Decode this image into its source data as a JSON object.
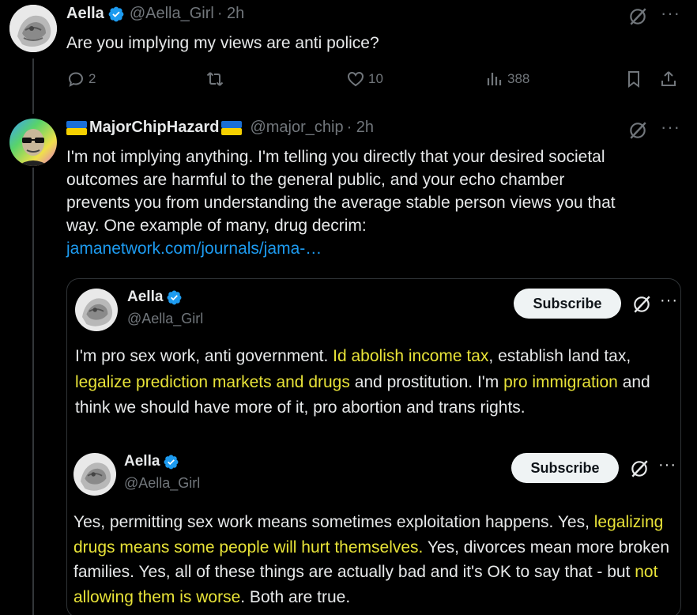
{
  "tweet1": {
    "name": "Aella",
    "handle": "@Aella_Girl",
    "time": "· 2h",
    "text": "Are you implying my views are anti police?",
    "replies": "2",
    "retweets": "",
    "likes": "10",
    "views": "388"
  },
  "tweet2": {
    "name": "MajorChipHazard",
    "handle": "@major_chip",
    "time": "· 2h",
    "text_lines": [
      "I'm not implying anything. I'm telling you directly that your desired societal",
      "outcomes are harmful to the general public, and your echo chamber",
      "prevents you from understanding the average stable person views you that",
      "way. One example of many, drug decrim:"
    ],
    "link": "jamanetwork.com/journals/jama-…"
  },
  "quote1": {
    "name": "Aella",
    "handle": "@Aella_Girl",
    "subscribe": "Subscribe",
    "seg": {
      "a": "I'm pro sex work, anti government. ",
      "b": "Id abolish income tax",
      "c": ", establish land tax, ",
      "d": "legalize prediction markets and drugs",
      "e": " and prostitution. I'm ",
      "f": "pro immigration",
      "g": " and think we should have more of it, pro abortion and trans rights."
    }
  },
  "quote2": {
    "name": "Aella",
    "handle": "@Aella_Girl",
    "subscribe": "Subscribe",
    "seg": {
      "a": "Yes, permitting sex work means sometimes exploitation happens. Yes, ",
      "b": "legalizing drugs means some people will hurt themselves.",
      "c": " Yes, divorces mean more broken families. Yes, all of these things are actually bad and it's OK to say that - but ",
      "d": "not allowing them is worse",
      "e": ". Both are true."
    }
  },
  "colors": {
    "background": "#000000",
    "link": "#1d9bf0",
    "highlight": "#e8e338",
    "muted": "#71767b",
    "verified": "#1d9bf0"
  },
  "icons": [
    "reply-icon",
    "retweet-icon",
    "like-icon",
    "views-icon",
    "bookmark-icon",
    "share-icon",
    "grok-icon",
    "more-icon",
    "verified-icon",
    "ukraine-flag-icon"
  ]
}
